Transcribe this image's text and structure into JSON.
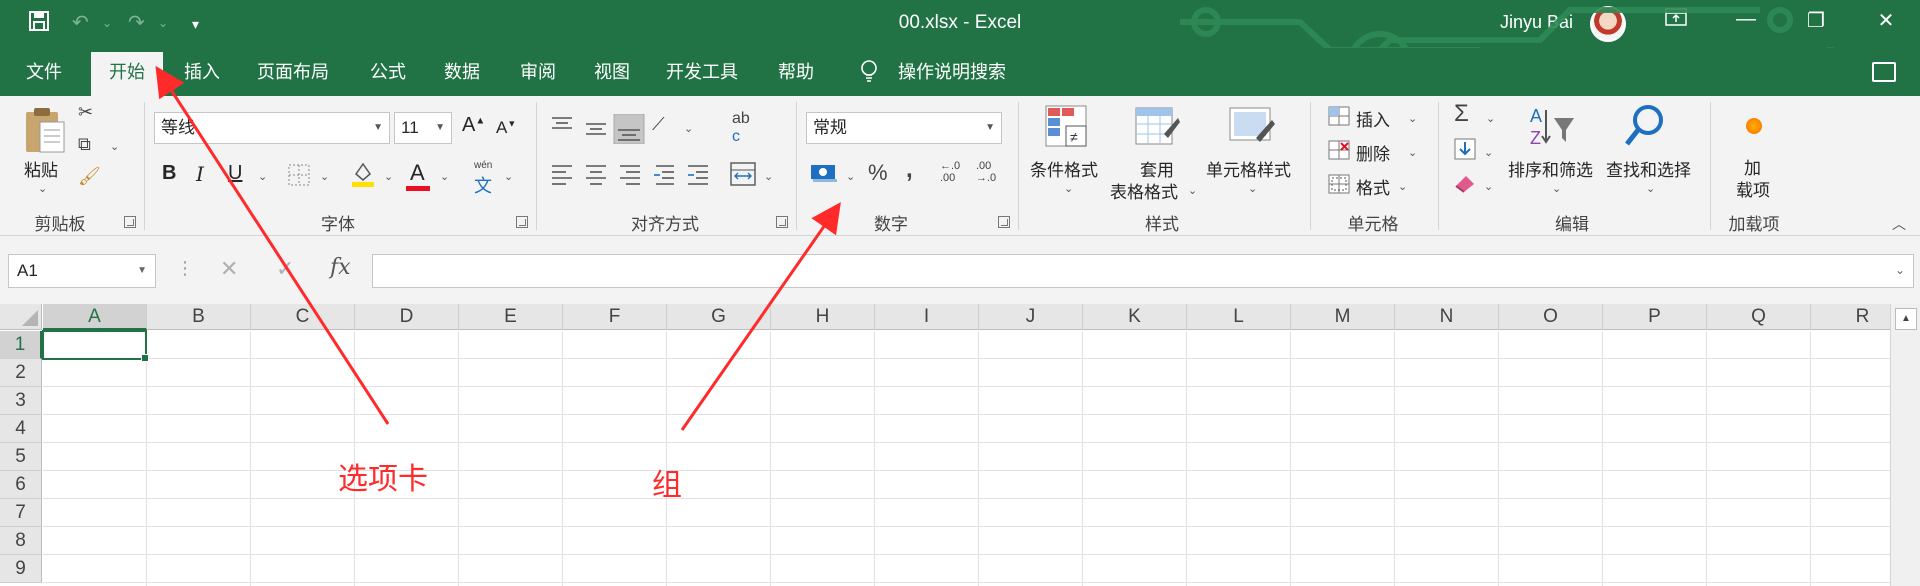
{
  "titlebar": {
    "title": "00.xlsx  -  Excel",
    "user": "Jinyu Bai",
    "save_icon": "save-icon",
    "undo_icon": "undo-icon",
    "redo_icon": "redo-icon",
    "customize_icon": "customize-qat-icon",
    "accent": "#217346"
  },
  "tabs": [
    {
      "label": "文件"
    },
    {
      "label": "开始"
    },
    {
      "label": "插入"
    },
    {
      "label": "页面布局"
    },
    {
      "label": "公式"
    },
    {
      "label": "数据"
    },
    {
      "label": "审阅"
    },
    {
      "label": "视图"
    },
    {
      "label": "开发工具"
    },
    {
      "label": "帮助"
    }
  ],
  "tell_me": "操作说明搜索",
  "ribbon": {
    "clipboard": {
      "paste": "粘贴",
      "label": "剪贴板"
    },
    "font": {
      "name": "等线",
      "size": "11",
      "label": "字体",
      "bold": "B",
      "italic": "I",
      "underline": "U",
      "grow": "A",
      "shrink": "A",
      "wen": "wén",
      "wen_char": "文",
      "font_color_letter": "A",
      "font_color": "#e81123",
      "fill_color": "#ffe000"
    },
    "alignment": {
      "label": "对齐方式",
      "wrap": "ab",
      "wrap2": "c"
    },
    "number": {
      "format": "常规",
      "label": "数字",
      "percent": "%",
      "comma": ",",
      "inc": "←.0\n.00",
      "dec": ".00\n→.0"
    },
    "styles": {
      "cond": "条件格式",
      "table1": "套用",
      "table2": "表格格式",
      "cell": "单元格样式",
      "label": "样式"
    },
    "cells": {
      "insert": "插入",
      "delete": "删除",
      "format": "格式",
      "label": "单元格"
    },
    "editing": {
      "sum": "Σ",
      "sort": "排序和筛选",
      "find": "查找和选择",
      "label": "编辑"
    },
    "addins": {
      "l1": "加",
      "l2": "载项",
      "label": "加载项"
    }
  },
  "formula_bar": {
    "name_box": "A1",
    "fx": "fx",
    "cancel": "✕",
    "enter": "✓",
    "value": ""
  },
  "columns": [
    "A",
    "B",
    "C",
    "D",
    "E",
    "F",
    "G",
    "H",
    "I",
    "J",
    "K",
    "L",
    "M",
    "N",
    "O",
    "P",
    "Q",
    "R"
  ],
  "rows": [
    "1",
    "2",
    "3",
    "4",
    "5",
    "6",
    "7",
    "8",
    "9"
  ],
  "annotations": {
    "tab_label": "选项卡",
    "group_label": "组",
    "color": "#ff2a2a"
  }
}
